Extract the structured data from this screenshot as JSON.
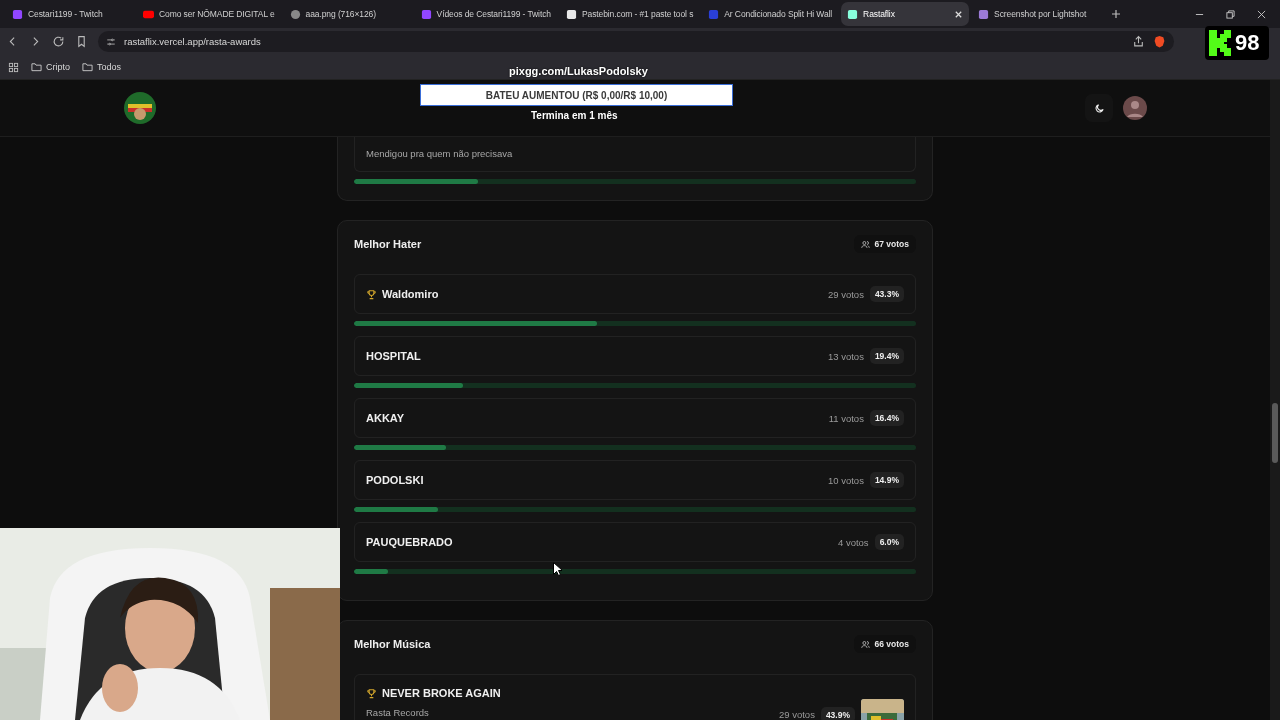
{
  "browser": {
    "tabs": [
      {
        "title": "Cestari1199 - Twitch",
        "selected": false
      },
      {
        "title": "Como ser NÔMADE DIGITAL e",
        "selected": false
      },
      {
        "title": "aaa.png (716×126)",
        "selected": false
      },
      {
        "title": "Vídeos de Cestari1199 - Twitch",
        "selected": false
      },
      {
        "title": "Pastebin.com - #1 paste tool s",
        "selected": false
      },
      {
        "title": "Ar Condicionado Split Hi Wall",
        "selected": false
      },
      {
        "title": "Rastaflix",
        "selected": true
      },
      {
        "title": "Screenshot por Lightshot",
        "selected": false
      }
    ],
    "url": "rastaflix.vercel.app/rasta-awards",
    "bookmarks": [
      "Cripto",
      "Todos"
    ]
  },
  "stream_overlay": {
    "donation_link": "pixgg.com/LukasPodolsky",
    "goal": "BATEU AUMENTOU (R$ 0,00/R$ 10,00)",
    "goal_ends": "Termina em 1 mês",
    "viewer_count": "98"
  },
  "previous_category": {
    "nominee_description": "Mendigou pra quem não precisava",
    "level": 0.22
  },
  "categories": [
    {
      "title": "Melhor Hater",
      "total": "67 votos",
      "nominees": [
        {
          "name": "Waldomiro",
          "winner": true,
          "votes": "29 votos",
          "percent": "43.3%",
          "level": 0.433
        },
        {
          "name": "HOSPITAL",
          "winner": false,
          "votes": "13 votos",
          "percent": "19.4%",
          "level": 0.194
        },
        {
          "name": "AKKAY",
          "winner": false,
          "votes": "11 votos",
          "percent": "16.4%",
          "level": 0.164
        },
        {
          "name": "PODOLSKI",
          "winner": false,
          "votes": "10 votos",
          "percent": "14.9%",
          "level": 0.149
        },
        {
          "name": "PAUQUEBRADO",
          "winner": false,
          "votes": "4 votos",
          "percent": "6.0%",
          "level": 0.06
        }
      ]
    },
    {
      "title": "Melhor Música",
      "total": "66 votos",
      "nominees": [
        {
          "name": "NEVER BROKE AGAIN",
          "description": "Rasta Records",
          "winner": true,
          "votes": "29 votos",
          "percent": "43.9%"
        }
      ]
    }
  ]
}
